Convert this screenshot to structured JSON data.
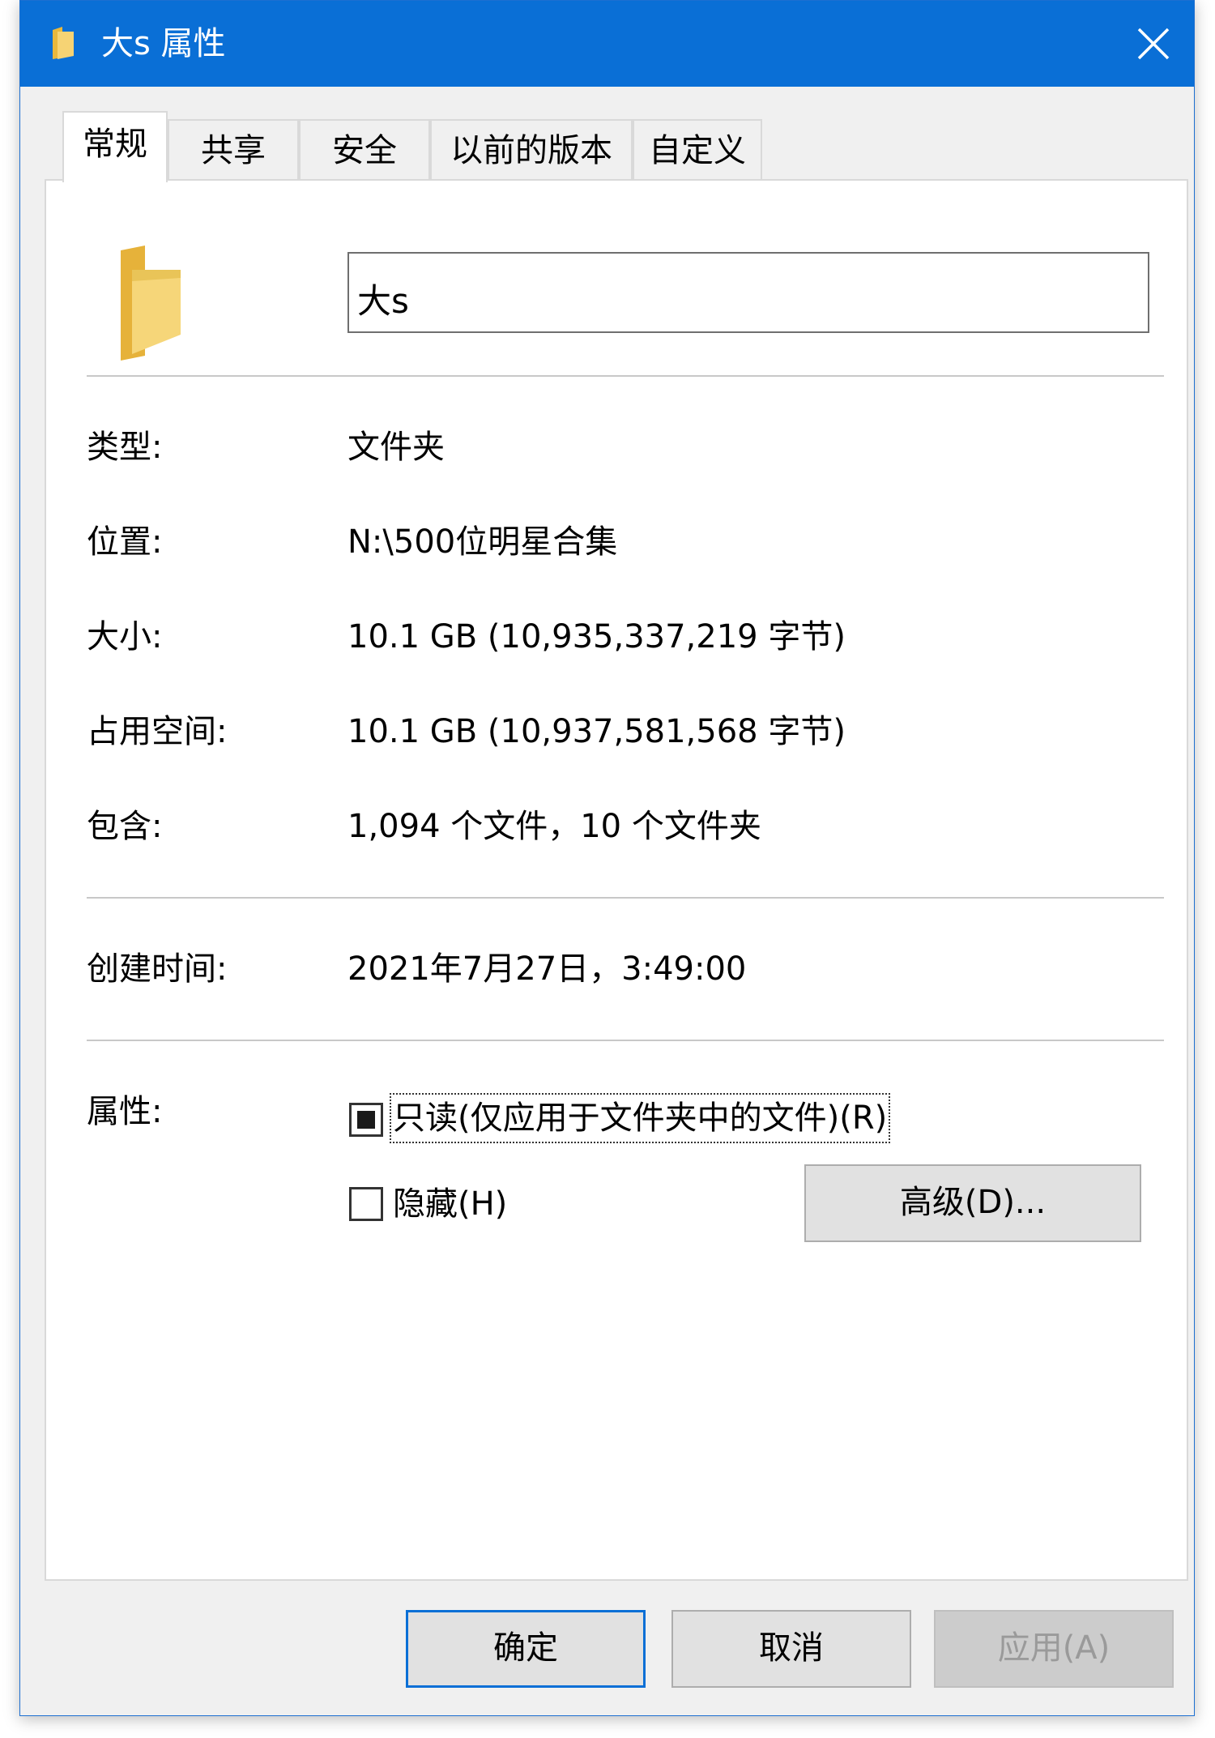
{
  "window": {
    "title": "大s 属性"
  },
  "tabs": [
    {
      "label": "常规",
      "active": true
    },
    {
      "label": "共享",
      "active": false
    },
    {
      "label": "安全",
      "active": false
    },
    {
      "label": "以前的版本",
      "active": false
    },
    {
      "label": "自定义",
      "active": false
    }
  ],
  "general": {
    "folder_name": "大s",
    "type": {
      "label": "类型:",
      "value": "文件夹"
    },
    "location": {
      "label": "位置:",
      "value": "N:\\500位明星合集"
    },
    "size": {
      "label": "大小:",
      "value": "10.1 GB (10,935,337,219 字节)"
    },
    "size_on_disk": {
      "label": "占用空间:",
      "value": "10.1 GB (10,937,581,568 字节)"
    },
    "contains": {
      "label": "包含:",
      "value": "1,094 个文件，10 个文件夹"
    },
    "created": {
      "label": "创建时间:",
      "value": "2021年7月27日，3:49:00"
    },
    "attributes": {
      "label": "属性:",
      "readonly": {
        "label": "只读(仅应用于文件夹中的文件)(R)",
        "state": "indeterminate"
      },
      "hidden": {
        "label": "隐藏(H)",
        "state": "unchecked"
      },
      "advanced_button": "高级(D)..."
    }
  },
  "buttons": {
    "ok": "确定",
    "cancel": "取消",
    "apply": "应用(A)"
  },
  "colors": {
    "titlebar": "#0a6fd6",
    "folder": "#f3cc63",
    "default_button_border": "#0a6fd6"
  },
  "icons": {
    "title": "folder-icon",
    "large": "folder-large-icon",
    "close": "close-icon"
  }
}
